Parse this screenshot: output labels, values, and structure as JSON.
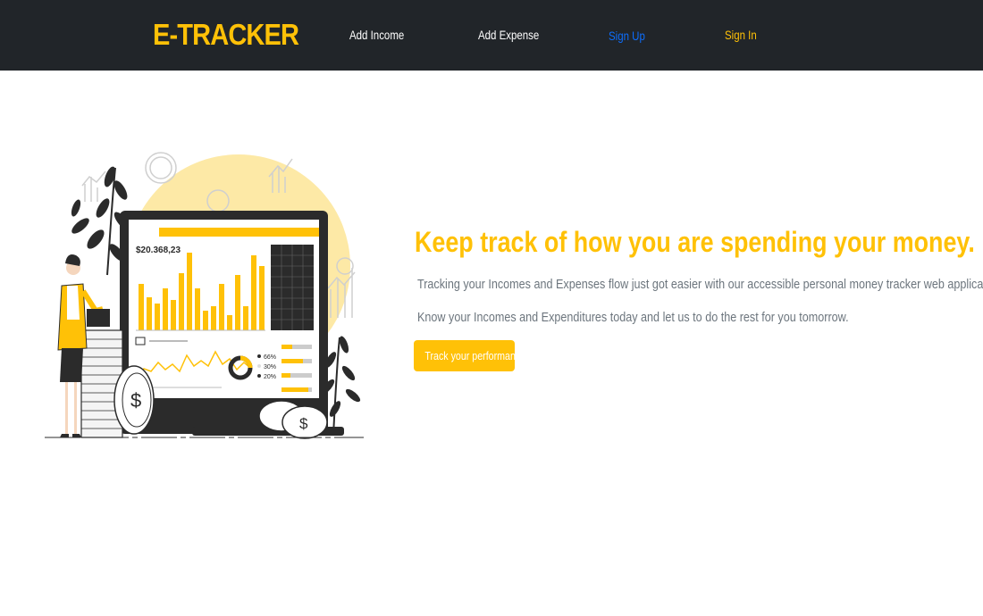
{
  "navbar": {
    "brand": "E-TRACKER",
    "links": {
      "add_income": "Add Income",
      "add_expense": "Add Expense",
      "sign_up": "Sign Up",
      "sign_in": "Sign In"
    }
  },
  "hero": {
    "title": "Keep track of how you are spending your money.",
    "paragraph_1": "Tracking your Incomes and Expenses flow just got easier with our accessible personal money tracker web application.",
    "paragraph_2": "Know your Incomes and Expenditures today and let us to do the rest for you tomorrow.",
    "cta_label": "Track your performance",
    "illustration": {
      "amount_label": "$20.368,23",
      "donut_labels": [
        "66%",
        "30%",
        "20%"
      ]
    }
  },
  "colors": {
    "accent": "#ffc107",
    "navbar_bg": "#212529",
    "link_blue": "#0d6efd",
    "text_muted": "#6c757d"
  }
}
